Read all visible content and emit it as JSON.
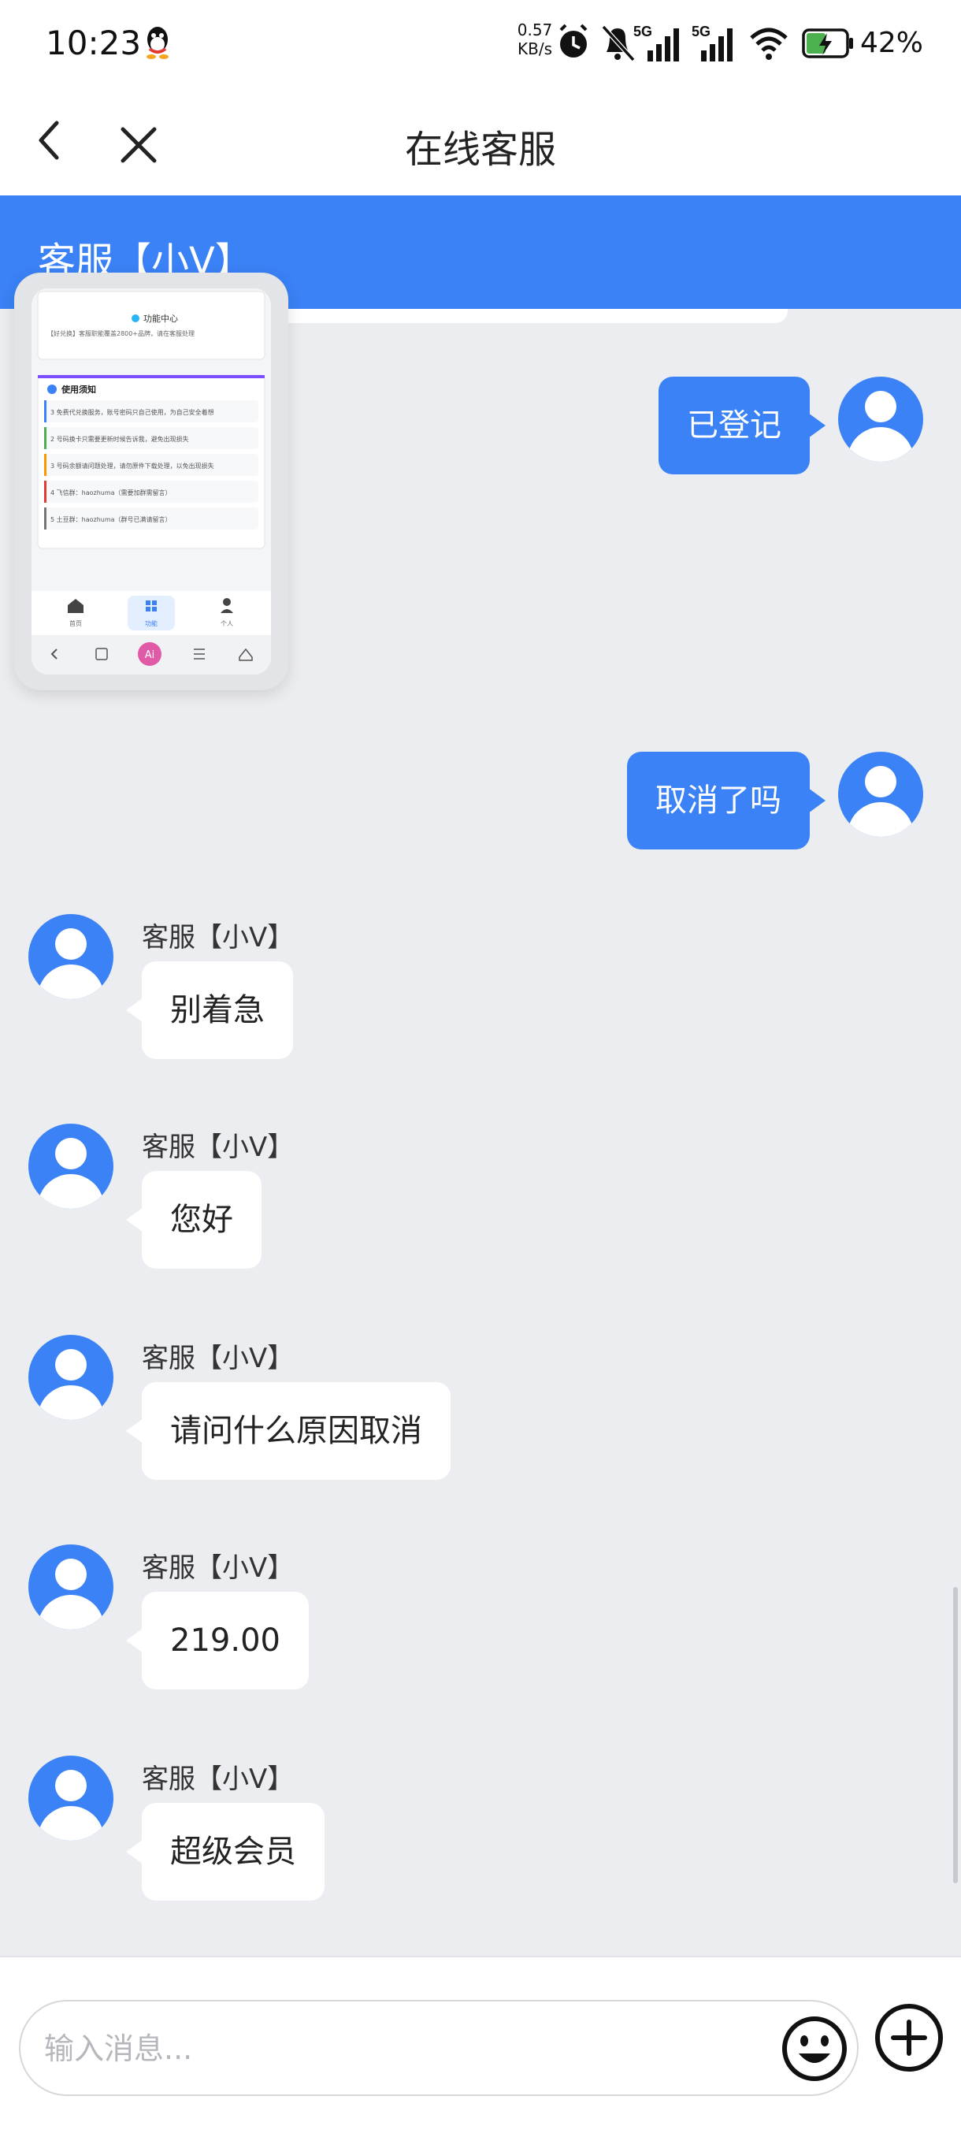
{
  "status_bar": {
    "time": "10:23",
    "net_speed_value": "0.57",
    "net_speed_unit": "KB/s",
    "signal_1_label": "5G",
    "signal_2_label": "5G",
    "battery_percent": "42%",
    "icons": [
      "qq-icon",
      "alarm-icon",
      "bell-muted-icon",
      "signal-icon",
      "signal-icon",
      "wifi-icon",
      "battery-charging-icon"
    ]
  },
  "nav": {
    "title": "在线客服"
  },
  "agent_header": {
    "title": "客服【小V】"
  },
  "thumbnail": {
    "header": "功能中心",
    "subheader": "【好兑换】客服职能覆盖2800+品牌，请在客服处理",
    "notice_title": "使用须知",
    "notice_items": [
      "3 免费代兑换服务，账号密码只自己使用，为自己安全着想",
      "2 号码换卡只需要更新时候告诉我，避免出现损失",
      "3 号码余额请问题处理，请勿原件下载处理，以免出现损失",
      "4 飞信群：haozhuma（需要加群需留言）",
      "5 土豆群：haozhuma（群号已满请留言）"
    ],
    "tabs": [
      "首页",
      "功能",
      "个人"
    ],
    "ai_label": "Ai"
  },
  "messages": [
    {
      "from": "user",
      "text": "已登记"
    },
    {
      "from": "user",
      "text": "取消了吗"
    },
    {
      "from": "agent",
      "sender": "客服【小V】",
      "text": "别着急"
    },
    {
      "from": "agent",
      "sender": "客服【小V】",
      "text": "您好"
    },
    {
      "from": "agent",
      "sender": "客服【小V】",
      "text": "请问什么原因取消"
    },
    {
      "from": "agent",
      "sender": "客服【小V】",
      "text": "219.00"
    },
    {
      "from": "agent",
      "sender": "客服【小V】",
      "text": "超级会员"
    }
  ],
  "input": {
    "placeholder": "输入消息..."
  },
  "colors": {
    "accent": "#3b82f6",
    "background": "#ecedf1"
  }
}
